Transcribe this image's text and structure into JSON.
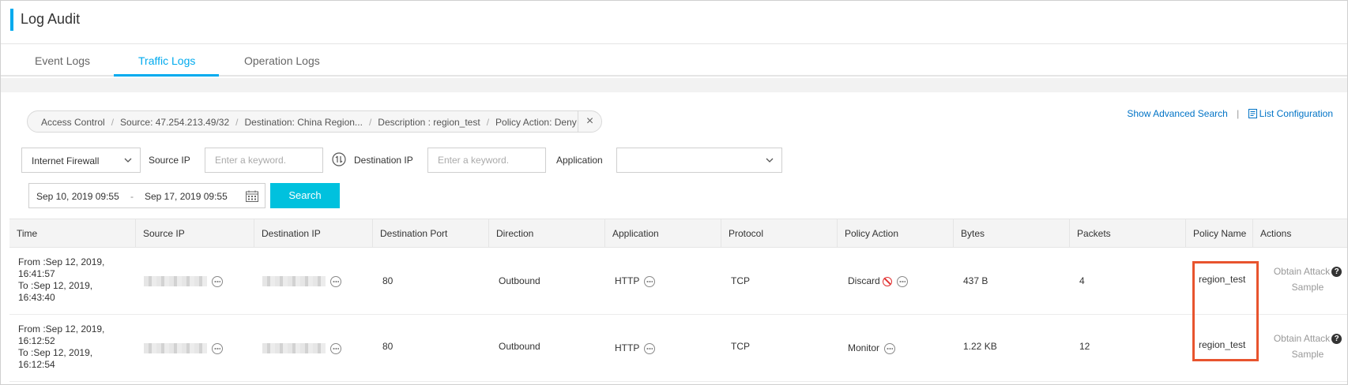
{
  "page": {
    "title": "Log Audit"
  },
  "tabs": [
    {
      "label": "Event Logs"
    },
    {
      "label": "Traffic Logs",
      "active": true
    },
    {
      "label": "Operation Logs"
    }
  ],
  "filter": {
    "segments": [
      "Access Control",
      "Source: 47.254.213.49/32",
      "Destination: China Region...",
      "Description : region_test",
      "Policy Action: Deny"
    ],
    "close_icon": "close-icon"
  },
  "links": {
    "advanced_search": "Show Advanced Search",
    "separator": "|",
    "list_configuration": "List Configuration"
  },
  "search": {
    "firewall_select": "Internet Firewall",
    "source_ip_label": "Source IP",
    "source_ip_placeholder": "Enter a keyword.",
    "destination_ip_label": "Destination IP",
    "destination_ip_placeholder": "Enter a keyword.",
    "application_label": "Application",
    "application_value": "",
    "date_from": "Sep 10, 2019 09:55",
    "date_separator": "-",
    "date_to": "Sep 17, 2019 09:55",
    "search_button": "Search"
  },
  "table": {
    "columns": [
      "Time",
      "Source IP",
      "Destination IP",
      "Destination Port",
      "Direction",
      "Application",
      "Protocol",
      "Policy Action",
      "Bytes",
      "Packets",
      "Policy Name",
      "Actions"
    ],
    "rows": [
      {
        "time_from_1": "From :Sep 12, 2019,",
        "time_from_2": "16:41:57",
        "time_to_1": "To :Sep 12, 2019,",
        "time_to_2": "16:43:40",
        "destination_port": "80",
        "direction": "Outbound",
        "application": "HTTP",
        "protocol": "TCP",
        "policy_action": "Discard",
        "bytes": "437 B",
        "packets": "4",
        "policy_name": "region_test",
        "action_line1": "Obtain Attack",
        "action_line2": "Sample"
      },
      {
        "time_from_1": "From :Sep 12, 2019,",
        "time_from_2": "16:12:52",
        "time_to_1": "To :Sep 12, 2019,",
        "time_to_2": "16:12:54",
        "destination_port": "80",
        "direction": "Outbound",
        "application": "HTTP",
        "protocol": "TCP",
        "policy_action": "Monitor",
        "bytes": "1.22 KB",
        "packets": "12",
        "policy_name": "region_test",
        "action_line1": "Obtain Attack",
        "action_line2": "Sample"
      }
    ]
  },
  "help_glyph": "?",
  "colors": {
    "accent": "#00aaee",
    "button": "#00c1de",
    "link": "#0073c6",
    "highlight": "#e8542e",
    "deny": "#e13333"
  }
}
